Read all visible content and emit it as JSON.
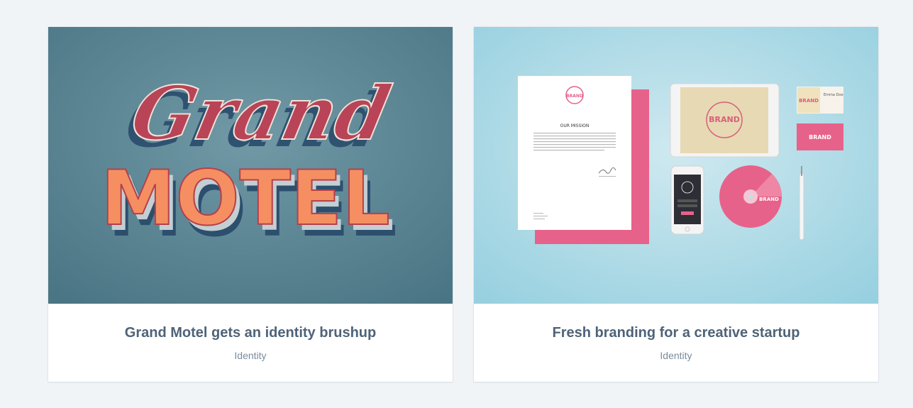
{
  "colors": {
    "page_bg": "#f1f4f7",
    "card_bg": "#ffffff",
    "title": "#4e6378",
    "category": "#7b8c9d",
    "motel_bg": "#5d8796",
    "motel_orange": "#f58f62",
    "brand_pink": "#e7628a",
    "branding_bg": "#a9d7e3"
  },
  "cards": [
    {
      "title": "Grand Motel gets an identity brushup",
      "category": "Identity",
      "art": {
        "script_word": "Grand",
        "block_word": "MOTEL"
      }
    },
    {
      "title": "Fresh branding for a creative startup",
      "category": "Identity",
      "art": {
        "heading": "OUR MISSION",
        "brand": "BRAND",
        "card_name": "Emma Doe"
      }
    }
  ]
}
